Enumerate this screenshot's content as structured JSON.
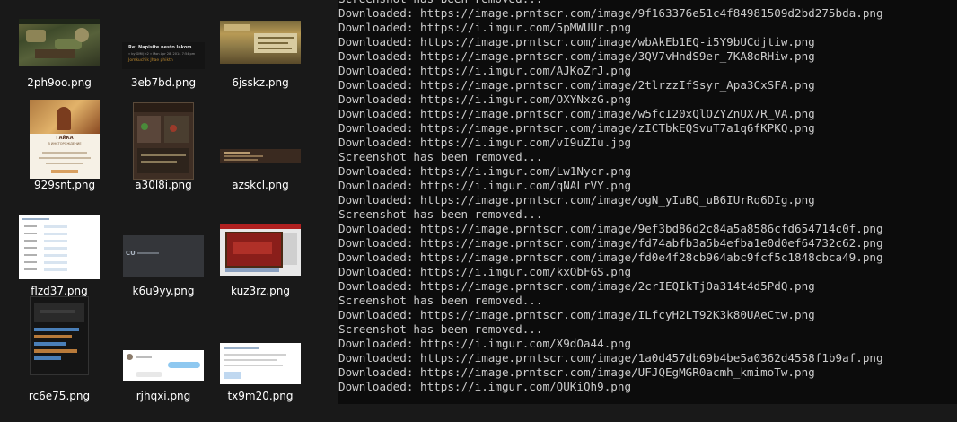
{
  "explorer": {
    "files": [
      {
        "name": "2ph9oo.png",
        "icon": "game-screenshot-thumbnail"
      },
      {
        "name": "3eb7bd.png",
        "icon": "forum-post-thumbnail",
        "preview": {
          "title": "Re: Napisite nesto lakom",
          "meta": "» by GMilJ «2 » Mon Apr 28, 2014 7:54 pm",
          "link": "Jomkuchik Jhae phiktn"
        }
      },
      {
        "name": "6jsskz.png",
        "icon": "game-screenshot-thumbnail"
      },
      {
        "name": "929snt.png",
        "icon": "poster-thumbnail",
        "preview": {
          "heading": "ГАЙКА",
          "subheading": "В ИНСТОРОЖДЕНИЕ"
        }
      },
      {
        "name": "a30l8i.png",
        "icon": "game-screenshot-thumbnail"
      },
      {
        "name": "azskcl.png",
        "icon": "game-screenshot-thumbnail"
      },
      {
        "name": "flzd37.png",
        "icon": "document-thumbnail"
      },
      {
        "name": "k6u9yy.png",
        "icon": "dark-app-thumbnail",
        "preview": {
          "logo": "CU"
        }
      },
      {
        "name": "kuz3rz.png",
        "icon": "game-screenshot-thumbnail"
      },
      {
        "name": "rc6e75.png",
        "icon": "dark-app-thumbnail"
      },
      {
        "name": "rjhqxi.png",
        "icon": "chat-thumbnail"
      },
      {
        "name": "tx9m20.png",
        "icon": "document-thumbnail"
      }
    ]
  },
  "console": {
    "lines": [
      "Screenshot has been removed...",
      "Downloaded: https://image.prntscr.com/image/9f163376e51c4f84981509d2bd275bda.png",
      "Downloaded: https://i.imgur.com/5pMWUUr.png",
      "Downloaded: https://image.prntscr.com/image/wbAkEb1EQ-i5Y9bUCdjtiw.png",
      "Downloaded: https://image.prntscr.com/image/3QV7vHndS9er_7KA8oRHiw.png",
      "Downloaded: https://i.imgur.com/AJKoZrJ.png",
      "Downloaded: https://image.prntscr.com/image/2tlrzzIfSsyr_Apa3CxSFA.png",
      "Downloaded: https://i.imgur.com/OXYNxzG.png",
      "Downloaded: https://image.prntscr.com/image/w5fcI20xQlOZYZnUX7R_VA.png",
      "Downloaded: https://image.prntscr.com/image/zICTbkEQSvuT7a1q6fKPKQ.png",
      "Downloaded: https://i.imgur.com/vI9uZIu.jpg",
      "Screenshot has been removed...",
      "Downloaded: https://i.imgur.com/Lw1Nycr.png",
      "Downloaded: https://i.imgur.com/qNALrVY.png",
      "Downloaded: https://image.prntscr.com/image/ogN_yIuBQ_uB6IUrRq6DIg.png",
      "Screenshot has been removed...",
      "Downloaded: https://image.prntscr.com/image/9ef3bd86d2c84a5a8586cfd654714c0f.png",
      "Downloaded: https://image.prntscr.com/image/fd74abfb3a5b4efba1e0d0ef64732c62.png",
      "Downloaded: https://image.prntscr.com/image/fd0e4f28cb964abc9fcf5c1848cbca49.png",
      "Downloaded: https://i.imgur.com/kxObFGS.png",
      "Downloaded: https://image.prntscr.com/image/2crIEQIkTjOa314t4d5PdQ.png",
      "Screenshot has been removed...",
      "Downloaded: https://image.prntscr.com/image/ILfcyH2LT92K3k80UAeCtw.png",
      "Screenshot has been removed...",
      "Downloaded: https://i.imgur.com/X9dOa44.png",
      "Downloaded: https://image.prntscr.com/image/1a0d457db69b4be5a0362d4558f1b9af.png",
      "Downloaded: https://image.prntscr.com/image/UFJQEgMGR0acmh_kmimoTw.png",
      "Downloaded: https://i.imgur.com/QUKiQh9.png"
    ]
  }
}
